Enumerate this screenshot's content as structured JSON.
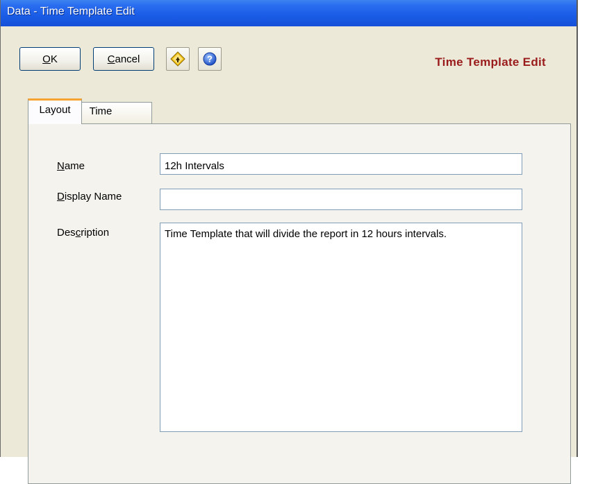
{
  "window": {
    "title": "Data - Time Template Edit"
  },
  "toolbar": {
    "ok_label": "OK",
    "cancel_label": "Cancel",
    "icons": [
      "template-diamond-icon",
      "help-icon"
    ]
  },
  "header": {
    "title": "Time Template Edit"
  },
  "tabs": [
    {
      "label": "Layout",
      "active": true
    },
    {
      "label": "Time",
      "active": false
    }
  ],
  "form": {
    "name_label": "Name",
    "display_name_label": "Display Name",
    "description_label": "Description",
    "name_value": "12h Intervals",
    "display_name_value": "",
    "description_value": "Time Template that will divide the report in 12 hours intervals."
  },
  "colors": {
    "title_bar": "#1a5ce6",
    "header_text": "#9a1b1b",
    "active_tab_accent": "#f5a433",
    "window_bg": "#ece9d8"
  }
}
